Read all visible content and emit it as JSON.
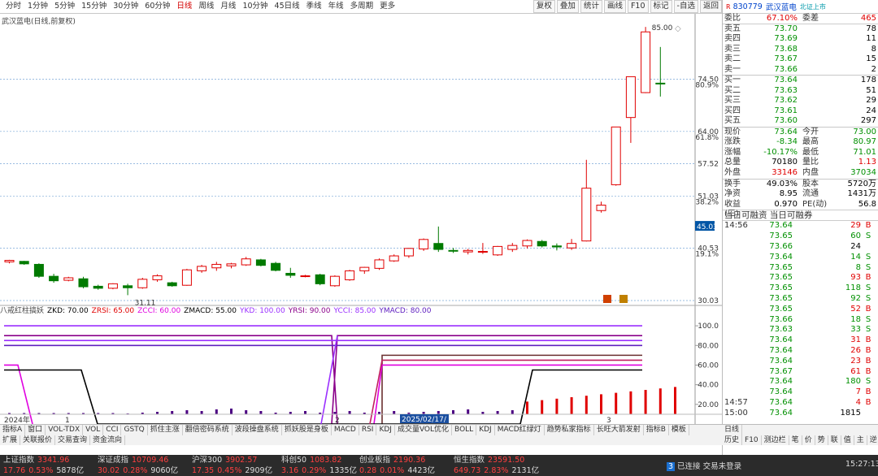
{
  "period_bar": {
    "items": [
      "分时",
      "1分钟",
      "5分钟",
      "15分钟",
      "30分钟",
      "60分钟",
      "日线",
      "周线",
      "月线",
      "10分钟",
      "45日线",
      "季线",
      "年线",
      "多周期",
      "更多"
    ],
    "active_index": 6,
    "tools": [
      "复权",
      "叠加",
      "统计",
      "画线",
      "F10",
      "标记",
      "-自选",
      "返回"
    ]
  },
  "stock": {
    "code": "830779",
    "name": "武汉蓝电",
    "note": "北证上市"
  },
  "chart": {
    "title": "武汉蓝电(日线,前复权)",
    "price_labels": [
      "74.50",
      "64.00",
      "57.52",
      "51.03",
      "40.53",
      "30.03"
    ],
    "pct_labels": [
      "80.9%",
      "61.8%",
      "38.2%",
      "19.1%"
    ],
    "current_price_tag": "45.03",
    "high_label": "85.00",
    "low_label": "31.11",
    "x_labels": [
      "2024年",
      "1",
      "2",
      "3"
    ],
    "date_tag": "2025/02/17/"
  },
  "chart_data": {
    "type": "candlestick",
    "title": "武汉蓝电(日线,前复权)",
    "ylim": [
      30.03,
      86
    ],
    "candles": [
      [
        37.8,
        38.2,
        37.5,
        38.1
      ],
      [
        37.9,
        38.0,
        37.2,
        37.4
      ],
      [
        37.3,
        37.5,
        34.6,
        34.9
      ],
      [
        34.9,
        35.4,
        33.6,
        34.0
      ],
      [
        34.1,
        34.8,
        33.9,
        34.6
      ],
      [
        34.4,
        34.8,
        32.5,
        32.8
      ],
      [
        32.9,
        33.2,
        32.2,
        32.5
      ],
      [
        32.5,
        33.5,
        32.3,
        33.4
      ],
      [
        33.0,
        33.4,
        31.11,
        32.6
      ],
      [
        32.6,
        34.6,
        32.4,
        34.3
      ],
      [
        34.2,
        35.3,
        33.8,
        35.0
      ],
      [
        33.6,
        33.8,
        32.8,
        33.0
      ],
      [
        33.1,
        36.4,
        33.0,
        36.2
      ],
      [
        36.0,
        37.2,
        35.6,
        36.9
      ],
      [
        36.6,
        37.8,
        36.0,
        37.3
      ],
      [
        37.0,
        37.6,
        36.5,
        37.4
      ],
      [
        37.2,
        38.8,
        37.0,
        38.4
      ],
      [
        38.2,
        38.4,
        36.9,
        37.1
      ],
      [
        37.5,
        37.8,
        35.9,
        36.1
      ],
      [
        35.5,
        36.6,
        34.6,
        35.1
      ],
      [
        35.0,
        35.2,
        34.7,
        35.0
      ],
      [
        35.2,
        35.4,
        33.1,
        33.4
      ],
      [
        33.0,
        35.1,
        32.8,
        34.9
      ],
      [
        34.2,
        36.2,
        34.0,
        36.0
      ],
      [
        36.0,
        36.8,
        35.4,
        36.7
      ],
      [
        36.5,
        38.5,
        36.2,
        38.2
      ],
      [
        38.0,
        39.3,
        37.8,
        39.0
      ],
      [
        39.0,
        40.6,
        38.6,
        40.5
      ],
      [
        40.4,
        42.5,
        40.0,
        42.3
      ],
      [
        41.5,
        44.9,
        39.8,
        40.3
      ],
      [
        40.1,
        40.6,
        39.6,
        40.0
      ],
      [
        39.8,
        40.4,
        39.3,
        40.1
      ],
      [
        39.9,
        41.6,
        39.4,
        39.9
      ],
      [
        39.2,
        41.0,
        39.0,
        40.9
      ],
      [
        40.3,
        41.6,
        39.8,
        41.1
      ],
      [
        41.0,
        42.3,
        40.5,
        42.1
      ],
      [
        41.9,
        42.2,
        40.7,
        41.0
      ],
      [
        41.0,
        41.5,
        40.1,
        40.8
      ],
      [
        40.6,
        42.4,
        40.2,
        41.5
      ],
      [
        42.0,
        58.3,
        41.9,
        52.6
      ],
      [
        48.1,
        49.9,
        47.7,
        49.2
      ],
      [
        53.3,
        58.6,
        53.1,
        64.9
      ],
      [
        66.8,
        66.9,
        61.7,
        75.0
      ],
      [
        71.8,
        85.0,
        71.7,
        84.0
      ],
      [
        73.7,
        80.97,
        71.01,
        73.64
      ]
    ]
  },
  "indicator": {
    "name": "八戒红柱搞妖",
    "params": [
      {
        "k": "ZKD",
        "v": "70.00"
      },
      {
        "k": "ZRSI",
        "v": "65.00"
      },
      {
        "k": "ZCCI",
        "v": "60.00"
      },
      {
        "k": "ZMACD",
        "v": "55.00"
      },
      {
        "k": "YKD",
        "v": "100.00"
      },
      {
        "k": "YRSI",
        "v": "90.00"
      },
      {
        "k": "YCCI",
        "v": "85.00"
      },
      {
        "k": "YMACD",
        "v": "80.00"
      }
    ],
    "y_labels": [
      "100.0",
      "80.00",
      "60.00",
      "40.00",
      "20.00"
    ]
  },
  "quote": {
    "webi_label": "委比",
    "webi_value": "67.10%",
    "wecha_label": "委差",
    "wecha_value": "465",
    "sell": [
      {
        "l": "卖五",
        "p": "73.70",
        "v": "78"
      },
      {
        "l": "卖四",
        "p": "73.69",
        "v": "11"
      },
      {
        "l": "卖三",
        "p": "73.68",
        "v": "8"
      },
      {
        "l": "卖二",
        "p": "73.67",
        "v": "15"
      },
      {
        "l": "卖一",
        "p": "73.66",
        "v": "2"
      }
    ],
    "buy": [
      {
        "l": "买一",
        "p": "73.64",
        "v": "178"
      },
      {
        "l": "买二",
        "p": "73.63",
        "v": "51"
      },
      {
        "l": "买三",
        "p": "73.62",
        "v": "29"
      },
      {
        "l": "买四",
        "p": "73.61",
        "v": "24"
      },
      {
        "l": "买五",
        "p": "73.60",
        "v": "297"
      }
    ],
    "stats": [
      {
        "l1": "现价",
        "v1": "73.64",
        "c1": "green",
        "l2": "今开",
        "v2": "73.00",
        "c2": "green"
      },
      {
        "l1": "涨跌",
        "v1": "-8.34",
        "c1": "green",
        "l2": "最高",
        "v2": "80.97",
        "c2": "green"
      },
      {
        "l1": "涨幅",
        "v1": "-10.17%",
        "c1": "green",
        "l2": "最低",
        "v2": "71.01",
        "c2": "green"
      },
      {
        "l1": "总量",
        "v1": "70180",
        "c1": "black",
        "l2": "量比",
        "v2": "1.13",
        "c2": "red"
      },
      {
        "l1": "外盘",
        "v1": "33146",
        "c1": "red",
        "l2": "内盘",
        "v2": "37034",
        "c2": "green"
      }
    ],
    "stats2": [
      {
        "l1": "换手",
        "v1": "49.03%",
        "c1": "black",
        "l2": "股本",
        "v2": "5720万",
        "c2": "black"
      },
      {
        "l1": "净资",
        "v1": "8.95",
        "c1": "black",
        "l2": "流通",
        "v2": "1431万",
        "c2": "black"
      },
      {
        "l1": "收益(三)",
        "v1": "0.970",
        "c1": "black",
        "l2": "PE(动)",
        "v2": "56.8",
        "c2": "black"
      }
    ],
    "financing": "当日可融资 当日可融券"
  },
  "ticks": [
    {
      "t": "14:56",
      "p": "73.64",
      "v": "29",
      "b": "B"
    },
    {
      "t": "",
      "p": "73.65",
      "v": "60",
      "b": "S"
    },
    {
      "t": "",
      "p": "73.66",
      "v": "24",
      "b": ""
    },
    {
      "t": "",
      "p": "73.64",
      "v": "14",
      "b": "S"
    },
    {
      "t": "",
      "p": "73.65",
      "v": "8",
      "b": "S"
    },
    {
      "t": "",
      "p": "73.65",
      "v": "93",
      "b": "B"
    },
    {
      "t": "",
      "p": "73.65",
      "v": "118",
      "b": "S"
    },
    {
      "t": "",
      "p": "73.65",
      "v": "92",
      "b": "S"
    },
    {
      "t": "",
      "p": "73.65",
      "v": "52",
      "b": "B"
    },
    {
      "t": "",
      "p": "73.66",
      "v": "18",
      "b": "S"
    },
    {
      "t": "",
      "p": "73.63",
      "v": "33",
      "b": "S"
    },
    {
      "t": "",
      "p": "73.64",
      "v": "31",
      "b": "B"
    },
    {
      "t": "",
      "p": "73.64",
      "v": "26",
      "b": "B"
    },
    {
      "t": "",
      "p": "73.64",
      "v": "23",
      "b": "B"
    },
    {
      "t": "",
      "p": "73.67",
      "v": "61",
      "b": "B"
    },
    {
      "t": "",
      "p": "73.64",
      "v": "180",
      "b": "S"
    },
    {
      "t": "",
      "p": "73.64",
      "v": "7",
      "b": "B"
    },
    {
      "t": "14:57",
      "p": "73.64",
      "v": "4",
      "b": "B"
    },
    {
      "t": "15:00",
      "p": "73.64",
      "v": "1815",
      "b": ""
    }
  ],
  "bottom_tabs": {
    "row1": [
      "指标A",
      "窗口",
      "VOL-TDX",
      "VOL",
      "CCI",
      "GSTQ",
      "抓住主涨",
      "翻倍密码系统",
      "波段操盘系统",
      "抓妖股是身板",
      "MACD",
      "RSI",
      "KDJ",
      "成交量VOL优化",
      "BOLL",
      "KDJ",
      "MACD红绿灯",
      "趋势私家指标",
      "长旺大箭发射",
      "指标B",
      "模板"
    ],
    "row2": [
      "扩展",
      "关联报价",
      "交易查询",
      "资金流向"
    ],
    "right1": [
      "日线"
    ],
    "right2": [
      "历史",
      "F10",
      "测边栏",
      "笔",
      "价",
      "势",
      "联",
      "值",
      "主",
      "逆",
      "筹"
    ]
  },
  "status": {
    "row1": [
      {
        "n": "上证指数",
        "v": "3341.96",
        "c": "#ff4040"
      },
      {
        "n": "深证成指",
        "v": "10709.46",
        "c": "#ff4040"
      },
      {
        "n": "沪深300",
        "v": "3902.57",
        "c": "#ff4040"
      },
      {
        "n": "科创50",
        "v": "1083.82",
        "c": "#ff4040"
      },
      {
        "n": "创业板指",
        "v": "2190.36",
        "c": "#ff4040"
      },
      {
        "n": "恒生指数",
        "v": "23591.50",
        "c": "#ff4040"
      }
    ],
    "row2": [
      {
        "a": "17.76",
        "b": "0.53%",
        "c": "5878亿"
      },
      {
        "a": "30.02",
        "b": "0.28%",
        "c": "9060亿"
      },
      {
        "a": "17.35",
        "b": "0.45%",
        "c": "2909亿"
      },
      {
        "a": "3.16",
        "b": "0.29%",
        "c": "1335亿"
      },
      {
        "a": "0.28",
        "b": "0.01%",
        "c": "4423亿"
      },
      {
        "a": "649.73",
        "b": "2.83%",
        "c": "2131亿"
      }
    ],
    "connection": "已连接 交易未登录",
    "time": "15:27:13"
  }
}
